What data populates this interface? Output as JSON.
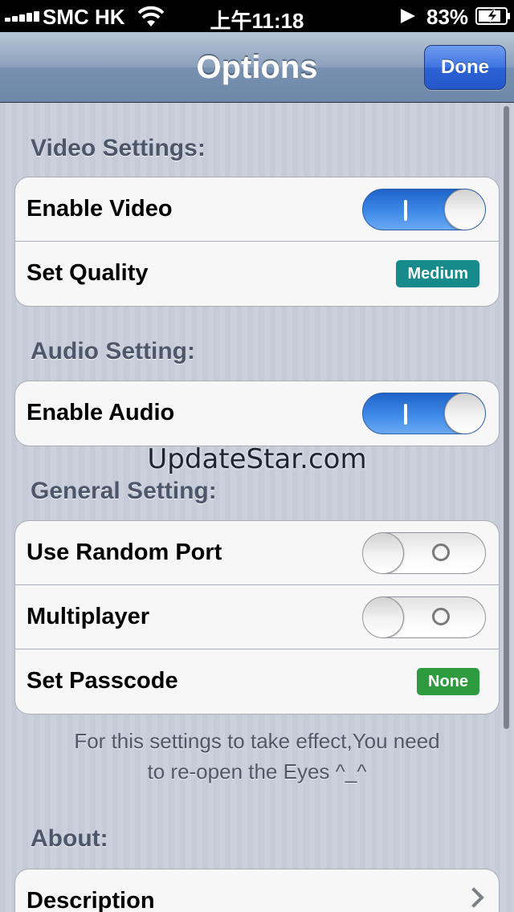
{
  "status_bar": {
    "carrier": "SMC HK",
    "time": "上午11:18",
    "battery_percent": "83%",
    "battery_level": 0.83
  },
  "nav": {
    "title": "Options",
    "done_label": "Done"
  },
  "sections": {
    "video": {
      "header": "Video Settings:",
      "enable_video": {
        "label": "Enable Video",
        "on": true
      },
      "set_quality": {
        "label": "Set Quality",
        "value": "Medium"
      }
    },
    "audio": {
      "header": "Audio Setting:",
      "enable_audio": {
        "label": "Enable Audio",
        "on": true
      }
    },
    "general": {
      "header": "General Setting:",
      "random_port": {
        "label": "Use Random Port",
        "on": false
      },
      "multiplayer": {
        "label": "Multiplayer",
        "on": false
      },
      "passcode": {
        "label": "Set Passcode",
        "value": "None"
      }
    },
    "note_line1": "For this settings to take effect,You need",
    "note_line2": "to re-open the Eyes ^_^",
    "about": {
      "header": "About:",
      "description": {
        "label": "Description"
      }
    }
  },
  "watermark": "UpdateStar.com",
  "colors": {
    "switch_on": "#3f8ae8",
    "badge_medium": "#178a8c",
    "badge_none": "#2e9b3f",
    "done_button": "#2d62d6"
  }
}
